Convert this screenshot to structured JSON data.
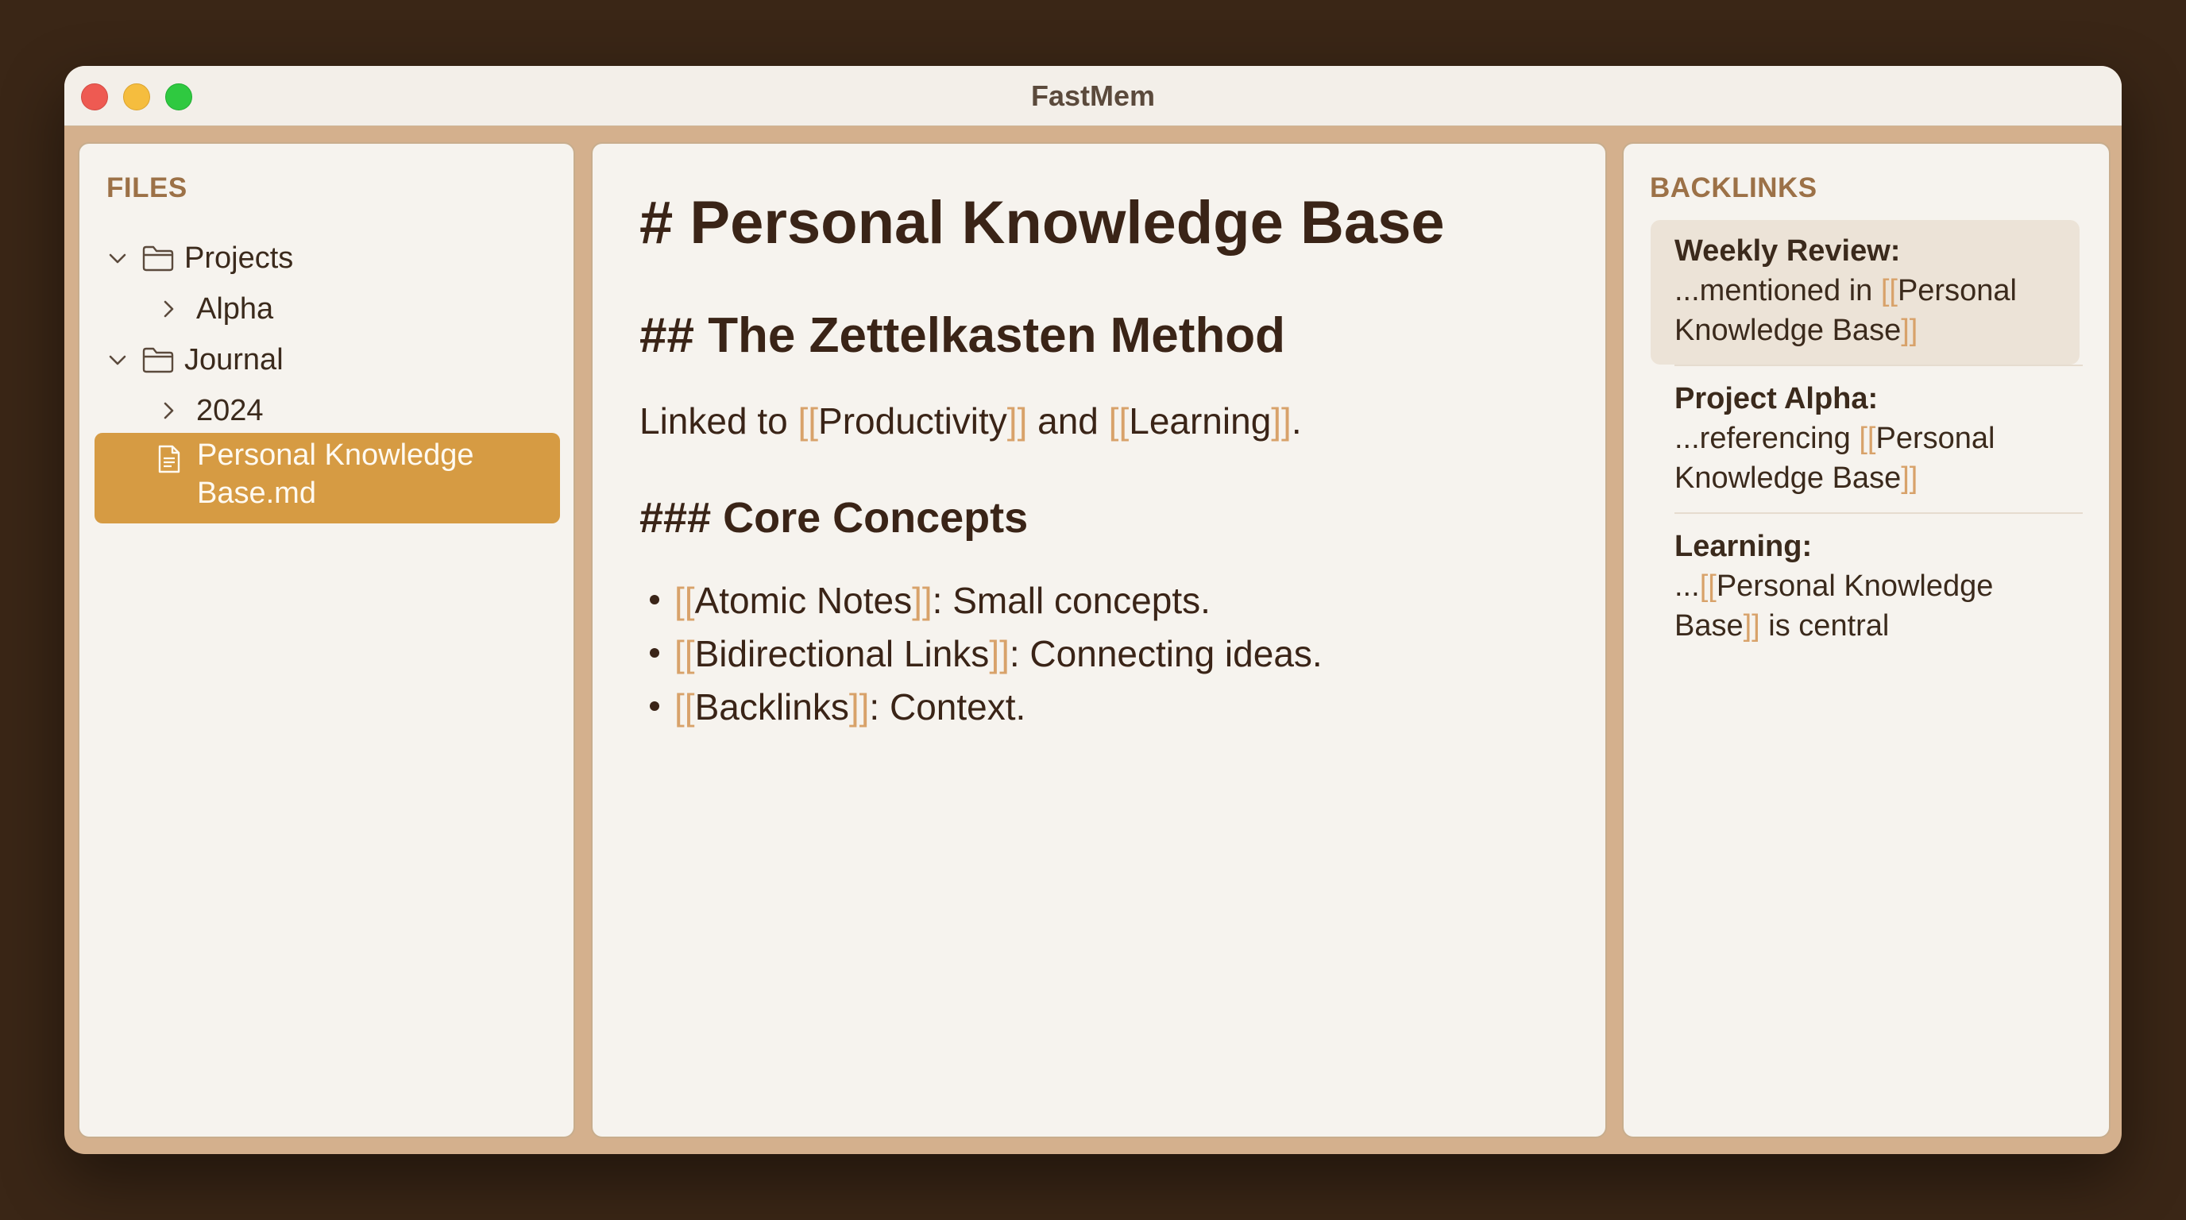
{
  "window": {
    "title": "FastMem"
  },
  "sidebar": {
    "heading": "FILES",
    "tree": [
      {
        "label": "Projects"
      },
      {
        "label": "Alpha"
      },
      {
        "label": "Journal"
      },
      {
        "label": "2024"
      }
    ],
    "selected_file": "Personal Knowledge Base.md"
  },
  "editor": {
    "h1": "# Personal Knowledge Base",
    "h2": "## The Zettelkasten Method",
    "para": {
      "prefix": "Linked to ",
      "link1": "Productivity",
      "mid": " and ",
      "link2": "Learning",
      "suffix": "."
    },
    "h3": "### Core Concepts",
    "bullets": [
      {
        "link": "Atomic Notes",
        "text": ": Small concepts."
      },
      {
        "link": "Bidirectional Links",
        "text": ": Connecting ideas."
      },
      {
        "link": "Backlinks",
        "text": ": Context."
      }
    ],
    "link_open": "[[",
    "link_close": "]]"
  },
  "backlinks": {
    "heading": "BACKLINKS",
    "items": [
      {
        "title": "Weekly Review:",
        "prefix": "...mentioned in ",
        "line1_link": "Personal",
        "line2_link": "Knowledge Base",
        "suffix": ""
      },
      {
        "title": "Project Alpha:",
        "prefix": "...referencing ",
        "line1_link": "Personal",
        "line2_link": "Knowledge Base",
        "suffix": ""
      },
      {
        "title": "Learning:",
        "prefix": "...",
        "line1_link": "Personal Knowledge",
        "line2_link": "Base",
        "suffix": " is central"
      }
    ]
  },
  "colors": {
    "accent": "#d69b43",
    "link_bracket": "#d8a26a",
    "text": "#3a2417",
    "label": "#9c7147"
  }
}
